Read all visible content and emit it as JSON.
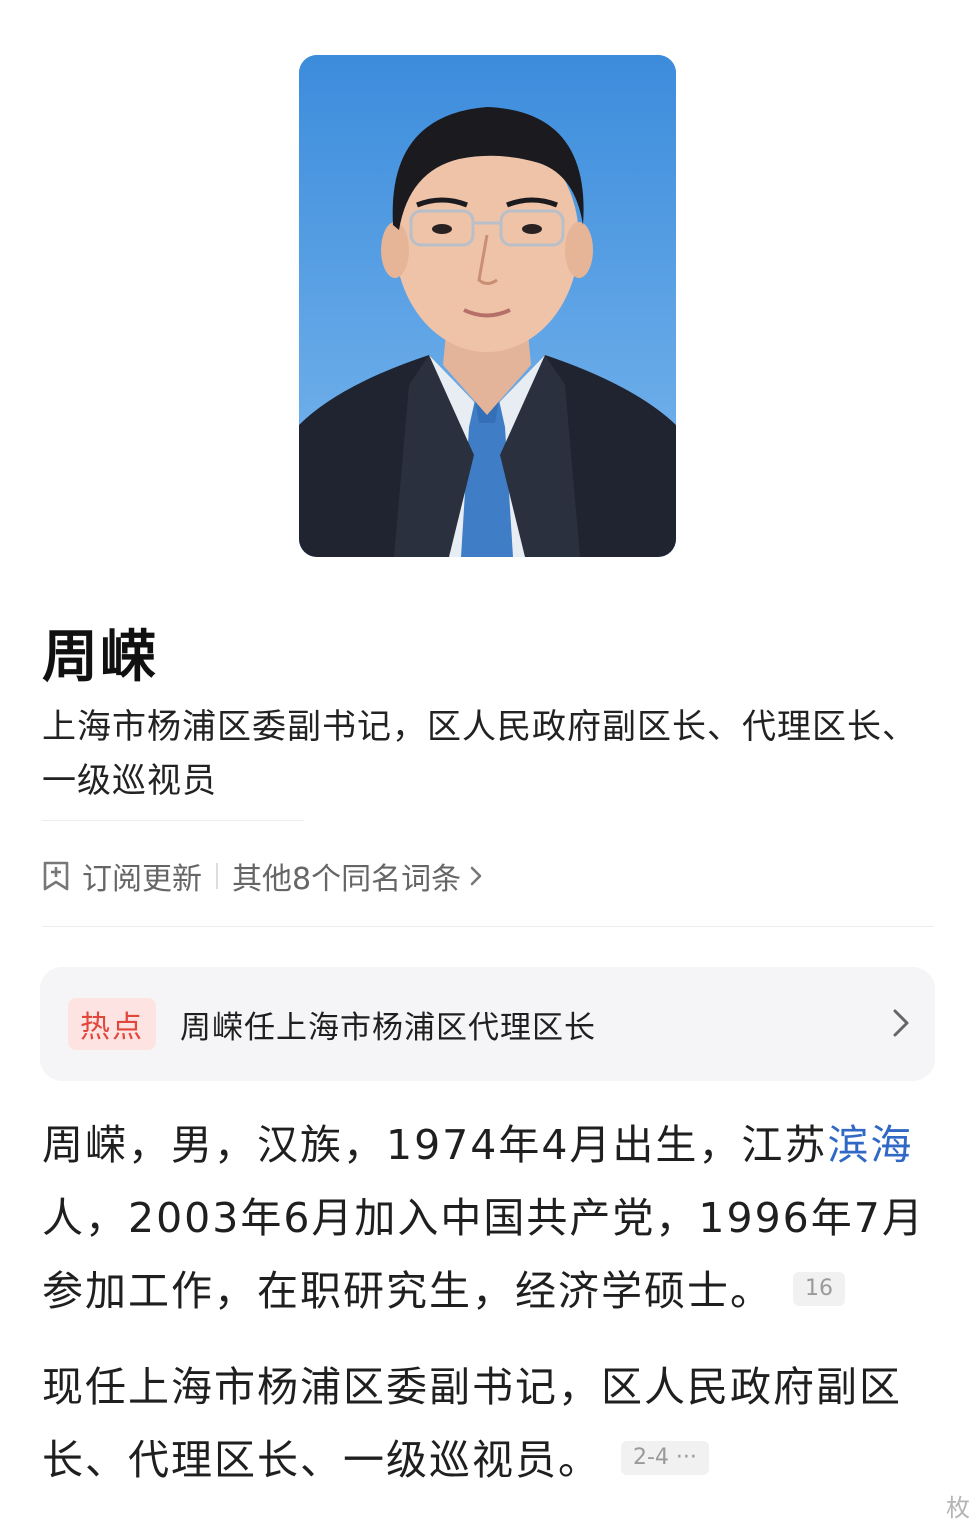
{
  "portrait": {
    "icon": "person-portrait",
    "background_color": "#4a97e2"
  },
  "person": {
    "name": "周嵘",
    "subtitle": "上海市杨浦区委副书记，区人民政府副区长、代理区长、一级巡视员"
  },
  "meta": {
    "subscribe_icon": "subscribe-icon",
    "subscribe_label": "订阅更新",
    "others_label": "其他8个同名词条",
    "others_icon": "chevron-right-icon"
  },
  "hot": {
    "badge": "热点",
    "title": "周嵘任上海市杨浦区代理区长",
    "badge_color": "#e2473d"
  },
  "intro": {
    "p1_before": "周嵘，男，汉族，1974年4月出生，江苏",
    "p1_link": "滨海",
    "p1_after": "人，2003年6月加入中国共产党，1996年7月参加工作，在职研究生，经济学硕士。",
    "p1_cite": "16",
    "p2_text": "现任上海市杨浦区委副书记，区人民政府副区长、代理区长、一级巡视员。",
    "p2_cite": "2-4 ···",
    "link_color": "#3168c6"
  },
  "watermark": {
    "text": "枚"
  }
}
